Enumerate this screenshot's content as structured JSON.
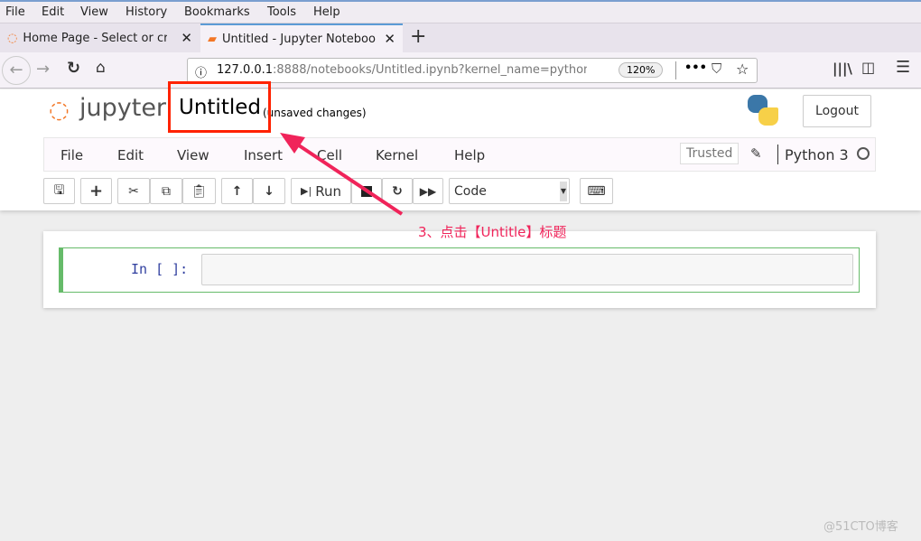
{
  "browser": {
    "menu": [
      "File",
      "Edit",
      "View",
      "History",
      "Bookmarks",
      "Tools",
      "Help"
    ],
    "tabs": [
      {
        "title": "Home Page - Select or create a notebook"
      },
      {
        "title": "Untitled - Jupyter Notebook"
      }
    ],
    "url_host": "127.0.0.1",
    "url_rest": ":8888/notebooks/Untitled.ipynb?kernel_name=python3",
    "zoom": "120%"
  },
  "jupyter": {
    "logo_text": "jupyter",
    "notebook_title": "Untitled",
    "save_status": "(unsaved changes)",
    "logout": "Logout",
    "menu": [
      "File",
      "Edit",
      "View",
      "Insert",
      "Cell",
      "Kernel",
      "Help"
    ],
    "trusted": "Trusted",
    "kernel": "Python 3",
    "toolbar": {
      "run": "Run",
      "cell_type": "Code"
    },
    "cell": {
      "prompt": "In [ ]:",
      "content": ""
    }
  },
  "annotation": {
    "text": "3、点击【Untitle】标题",
    "color": "#f0245a",
    "highlight_color": "#ff2200"
  },
  "watermark": "@51CTO博客"
}
